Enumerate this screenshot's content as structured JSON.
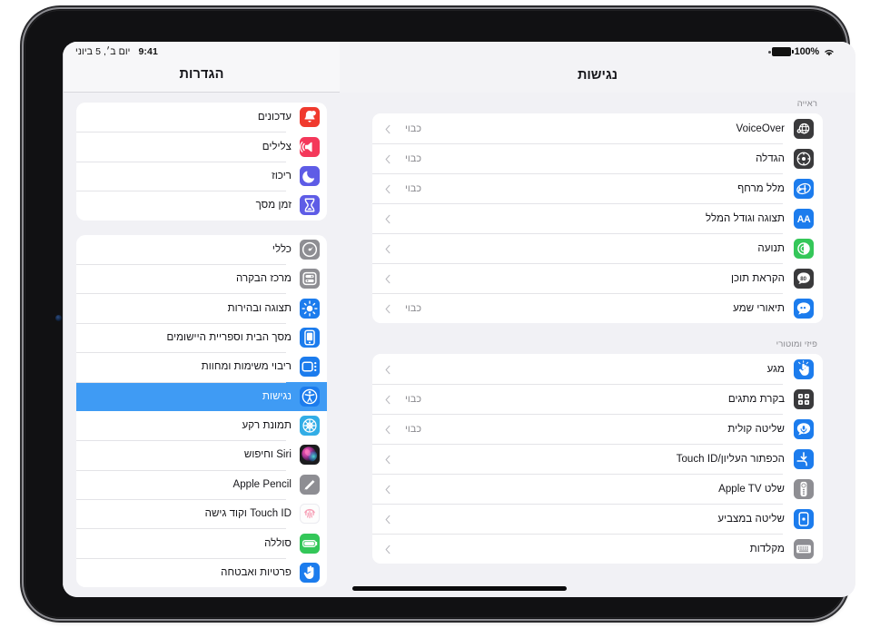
{
  "status_bar": {
    "battery_percent": "100%",
    "battery_icon": "battery-full-icon",
    "wifi_icon": "wifi-icon",
    "clock": "9:41",
    "date": "יום ב׳, 5 ביוני"
  },
  "sidebar": {
    "title": "הגדרות",
    "groups": [
      {
        "items": [
          {
            "label": "עדכונים",
            "icon": "bell-badge-icon",
            "color": "#f03a2e",
            "selected": false
          },
          {
            "label": "צלילים",
            "icon": "speaker-waves-icon",
            "color": "#f4385a",
            "selected": false
          },
          {
            "label": "ריכוז",
            "icon": "moon-icon",
            "color": "#5e5ce6",
            "selected": false
          },
          {
            "label": "זמן מסך",
            "icon": "hourglass-icon",
            "color": "#5e5ce6",
            "selected": false
          }
        ]
      },
      {
        "items": [
          {
            "label": "כללי",
            "icon": "gear-icon",
            "color": "#8e8e93",
            "selected": false
          },
          {
            "label": "מרכז הבקרה",
            "icon": "control-center-icon",
            "color": "#8e8e93",
            "selected": false
          },
          {
            "label": "תצוגה ובהירות",
            "icon": "brightness-icon",
            "color": "#1c7ced",
            "selected": false
          },
          {
            "label": "מסך הבית וספריית היישומים",
            "icon": "home-screen-icon",
            "color": "#1c7ced",
            "selected": false
          },
          {
            "label": "ריבוי משימות ומחוות",
            "icon": "multitasking-icon",
            "color": "#1c7ced",
            "selected": false
          },
          {
            "label": "נגישות",
            "icon": "accessibility-icon",
            "color": "#1c7ced",
            "selected": true
          },
          {
            "label": "תמונת רקע",
            "icon": "wallpaper-icon",
            "color": "#32ade6",
            "selected": false
          },
          {
            "label": "Siri וחיפוש",
            "icon": "siri-icon",
            "color": "#1c1c1e",
            "selected": false
          },
          {
            "label": "Apple Pencil",
            "icon": "pencil-icon",
            "color": "#8e8e93",
            "selected": false
          },
          {
            "label": "Touch ID וקוד גישה",
            "icon": "touch-id-icon",
            "color": "#fdfdfd",
            "selected": false
          },
          {
            "label": "סוללה",
            "icon": "battery-icon",
            "color": "#34c759",
            "selected": false
          },
          {
            "label": "פרטיות ואבטחה",
            "icon": "privacy-hand-icon",
            "color": "#1c7ced",
            "selected": false
          }
        ]
      }
    ]
  },
  "main": {
    "title": "נגישות",
    "sections": [
      {
        "header": "ראייה",
        "rows": [
          {
            "label": "VoiceOver",
            "value": "כבוי",
            "icon": "voiceover-icon",
            "color": "#3a3a3c"
          },
          {
            "label": "הגדלה",
            "value": "כבוי",
            "icon": "zoom-icon",
            "color": "#3a3a3c"
          },
          {
            "label": "מלל מרחף",
            "value": "כבוי",
            "icon": "hover-text-icon",
            "color": "#1c7ced"
          },
          {
            "label": "תצוגה וגודל המלל",
            "value": "",
            "icon": "text-size-icon",
            "color": "#1c7ced"
          },
          {
            "label": "תנועה",
            "value": "",
            "icon": "motion-icon",
            "color": "#34c759"
          },
          {
            "label": "הקראת תוכן",
            "value": "",
            "icon": "spoken-content-icon",
            "color": "#3a3a3c"
          },
          {
            "label": "תיאורי שמע",
            "value": "כבוי",
            "icon": "audio-desc-icon",
            "color": "#1c7ced"
          }
        ]
      },
      {
        "header": "פיזי ומוטורי",
        "rows": [
          {
            "label": "מגע",
            "value": "",
            "icon": "touch-icon",
            "color": "#1c7ced"
          },
          {
            "label": "בקרת מתגים",
            "value": "כבוי",
            "icon": "switch-control-icon",
            "color": "#3a3a3c"
          },
          {
            "label": "שליטה קולית",
            "value": "כבוי",
            "icon": "voice-control-icon",
            "color": "#1c7ced"
          },
          {
            "label": "הכפתור העליון/Touch ID",
            "value": "",
            "icon": "top-button-icon",
            "color": "#1c7ced"
          },
          {
            "label": "שלט Apple TV",
            "value": "",
            "icon": "apple-tv-remote-icon",
            "color": "#8e8e93"
          },
          {
            "label": "שליטה במצביע",
            "value": "",
            "icon": "pointer-control-icon",
            "color": "#1c7ced"
          },
          {
            "label": "מקלדות",
            "value": "",
            "icon": "keyboard-icon",
            "color": "#8e8e93"
          }
        ]
      }
    ]
  },
  "colors": {
    "accent": "#3f9bf4",
    "background": "#f1f1f5",
    "card": "#ffffff",
    "separator": "#e3e3e7",
    "secondary_text": "#8a8a8f"
  }
}
